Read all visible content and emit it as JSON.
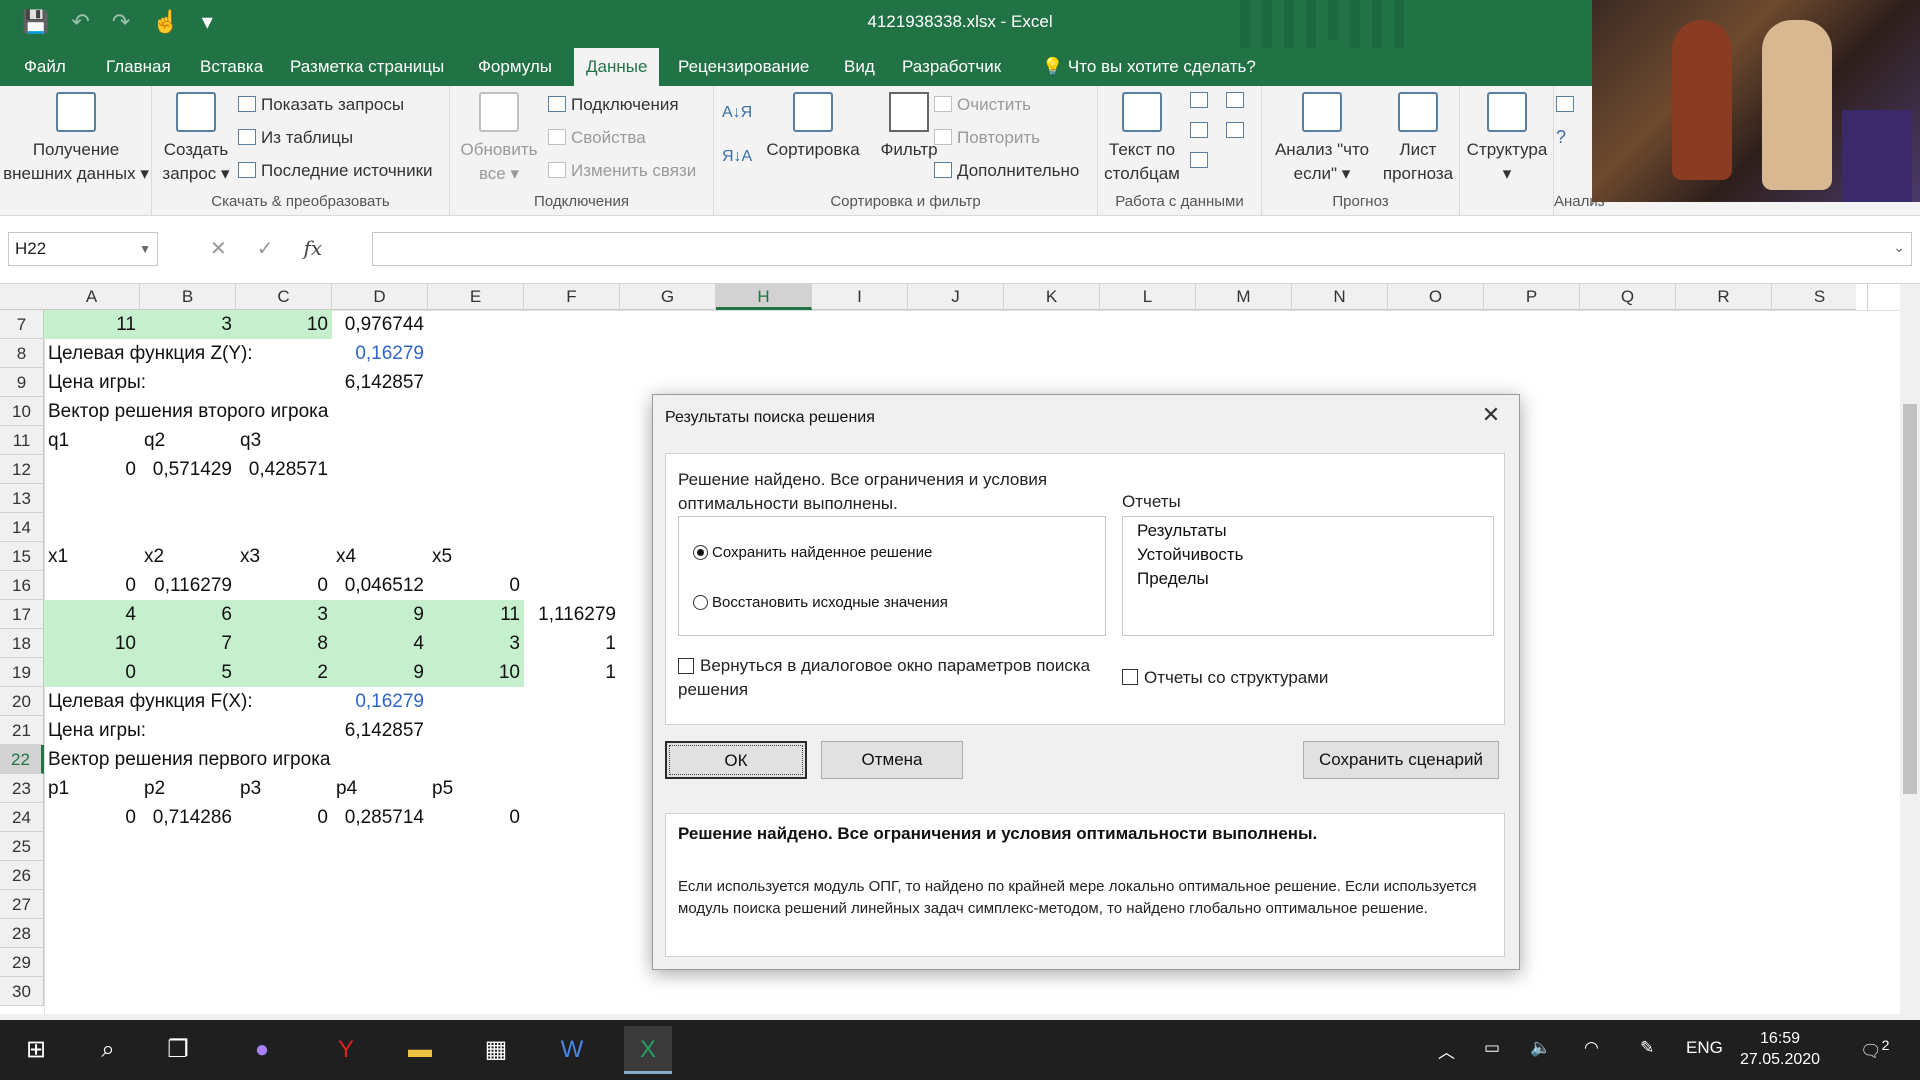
{
  "window": {
    "title": "4121938338.xlsx - Excel"
  },
  "tabs": [
    "Файл",
    "Главная",
    "Вставка",
    "Разметка страницы",
    "Формулы",
    "Данные",
    "Рецензирование",
    "Вид",
    "Разработчик"
  ],
  "tell_me": "Что вы хотите сделать?",
  "ribbon": {
    "get_external": [
      "Получение",
      "внешних данных"
    ],
    "create_query": [
      "Создать",
      "запрос"
    ],
    "show_queries": "Показать запросы",
    "from_table": "Из таблицы",
    "recent_sources": "Последние источники",
    "group_transform": "Скачать & преобразовать",
    "refresh_all": [
      "Обновить",
      "все"
    ],
    "connections": "Подключения",
    "properties": "Свойства",
    "edit_links": "Изменить связи",
    "group_connections": "Подключения",
    "sort": "Сортировка",
    "filter": "Фильтр",
    "clear": "Очистить",
    "reapply": "Повторить",
    "advanced": "Дополнительно",
    "group_sort": "Сортировка и фильтр",
    "text_to_columns": [
      "Текст по",
      "столбцам"
    ],
    "group_data_tools": "Работа с данными",
    "what_if": [
      "Анализ \"что",
      "если\""
    ],
    "forecast_sheet": [
      "Лист",
      "прогноза"
    ],
    "group_forecast": "Прогноз",
    "outline": "Структура",
    "group_analysis": "Анализ"
  },
  "formula_bar": {
    "name_box": "H22",
    "fx": "fx",
    "value": ""
  },
  "columns": [
    "A",
    "B",
    "C",
    "D",
    "E",
    "F",
    "G",
    "H",
    "I",
    "J",
    "K",
    "L",
    "M",
    "N",
    "O",
    "P",
    "Q",
    "R",
    "S"
  ],
  "selected_column": "H",
  "rows": [
    "7",
    "8",
    "9",
    "10",
    "11",
    "12",
    "13",
    "14",
    "15",
    "16",
    "17",
    "18",
    "19",
    "20",
    "21",
    "22",
    "23",
    "24",
    "25",
    "26",
    "27",
    "28",
    "29",
    "30"
  ],
  "selected_row": "22",
  "cells": {
    "r7": [
      "11",
      "3",
      "10",
      "0,976744"
    ],
    "r8_label": "Целевая функция Z(Y):",
    "r8_val": "0,16279",
    "r9_label": "Цена игры:",
    "r9_val": "6,142857",
    "r10_label": "Вектор решения второго игрока",
    "r11": [
      "q1",
      "q2",
      "q3"
    ],
    "r12": [
      "0",
      "0,571429",
      "0,428571"
    ],
    "r15": [
      "x1",
      "x2",
      "x3",
      "x4",
      "x5"
    ],
    "r16": [
      "0",
      "0,116279",
      "0",
      "0,046512",
      "0"
    ],
    "r17": [
      "4",
      "6",
      "3",
      "9",
      "11",
      "1,116279"
    ],
    "r18": [
      "10",
      "7",
      "8",
      "4",
      "3",
      "1"
    ],
    "r19": [
      "0",
      "5",
      "2",
      "9",
      "10",
      "1"
    ],
    "r20_label": "Целевая функция F(X):",
    "r20_val": "0,16279",
    "r21_label": "Цена игры:",
    "r21_val": "6,142857",
    "r22_label": "Вектор решения первого игрока",
    "r23": [
      "p1",
      "p2",
      "p3",
      "p4",
      "p5"
    ],
    "r24": [
      "0",
      "0,714286",
      "0",
      "0,285714",
      "0"
    ]
  },
  "dialog": {
    "title": "Результаты поиска решения",
    "message": "Решение найдено. Все ограничения и условия оптимальности выполнены.",
    "radio_keep": "Сохранить найденное решение",
    "radio_restore": "Восстановить исходные значения",
    "reports_label": "Отчеты",
    "reports": [
      "Результаты",
      "Устойчивость",
      "Пределы"
    ],
    "return_checkbox": "Вернуться в диалоговое окно параметров поиска решения",
    "outline_reports": "Отчеты со структурами",
    "ok": "ОК",
    "cancel": "Отмена",
    "save_scenario": "Сохранить сценарий",
    "info_bold": "Решение найдено. Все ограничения и условия оптимальности выполнены.",
    "info_text": "Если используется модуль ОПГ, то найдено по крайней мере локально оптимальное решение. Если используется модуль поиска решений линейных задач симплекс-методом, то найдено глобально оптимальное решение."
  },
  "taskbar": {
    "lang": "ENG",
    "time": "16:59",
    "date": "27.05.2020",
    "notifications": "2"
  }
}
